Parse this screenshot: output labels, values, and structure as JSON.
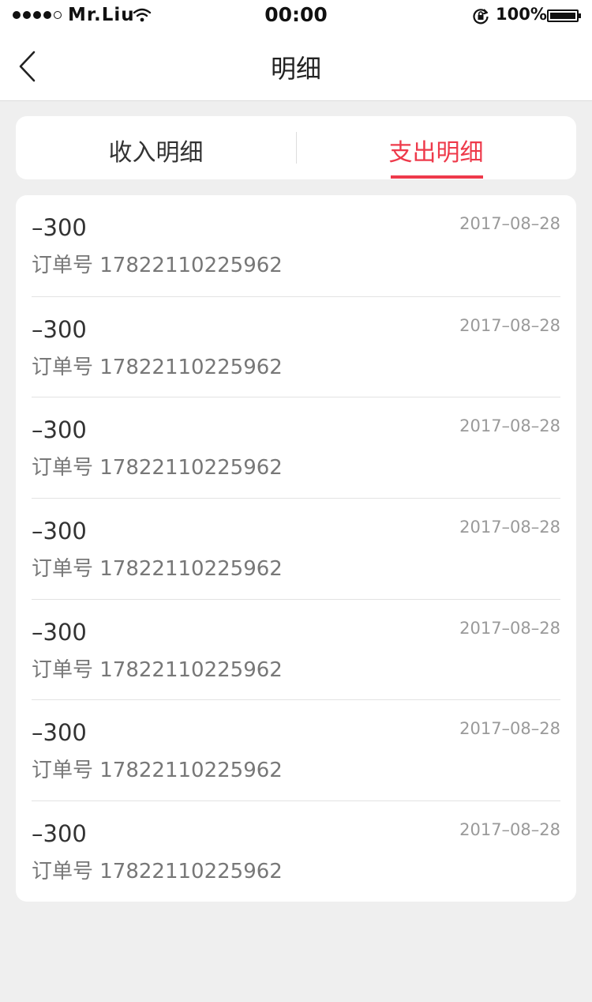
{
  "status_bar": {
    "carrier": "Mr.Liu",
    "time": "00:00",
    "battery": "100%"
  },
  "nav": {
    "title": "明细"
  },
  "tabs": [
    {
      "label": "收入明细",
      "active": false
    },
    {
      "label": "支出明细",
      "active": true
    }
  ],
  "colors": {
    "accent": "#ee3a4b",
    "background": "#efefef"
  },
  "records": [
    {
      "amount": "–300",
      "date": "2017–08–28",
      "order": "订单号 17822110225962"
    },
    {
      "amount": "–300",
      "date": "2017–08–28",
      "order": "订单号 17822110225962"
    },
    {
      "amount": "–300",
      "date": "2017–08–28",
      "order": "订单号 17822110225962"
    },
    {
      "amount": "–300",
      "date": "2017–08–28",
      "order": "订单号 17822110225962"
    },
    {
      "amount": "–300",
      "date": "2017–08–28",
      "order": "订单号 17822110225962"
    },
    {
      "amount": "–300",
      "date": "2017–08–28",
      "order": "订单号 17822110225962"
    },
    {
      "amount": "–300",
      "date": "2017–08–28",
      "order": "订单号 17822110225962"
    }
  ]
}
